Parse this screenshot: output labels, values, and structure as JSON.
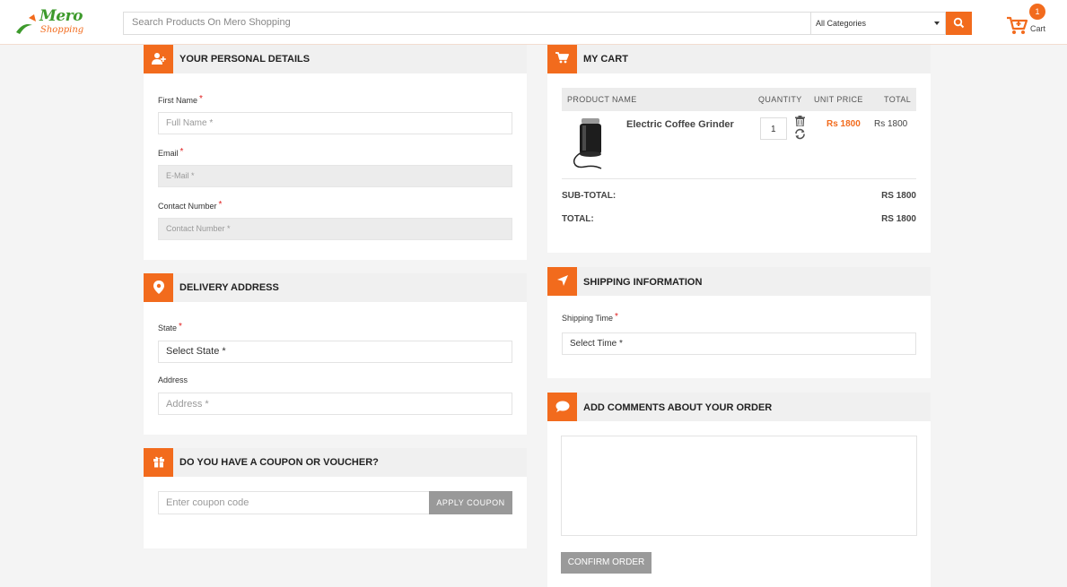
{
  "header": {
    "logo_line1": "Mero",
    "logo_line2": "Shopping",
    "search_placeholder": "Search Products On Mero Shopping",
    "category_selected": "All Categories",
    "cart_count": "1",
    "cart_label": "Cart"
  },
  "personal": {
    "title": "YOUR PERSONAL DETAILS",
    "first_name_label": "First Name",
    "first_name_placeholder": "Full Name *",
    "email_label": "Email",
    "email_placeholder": "E-Mail *",
    "contact_label": "Contact Number",
    "contact_placeholder": "Contact Number *",
    "required_mark": "*"
  },
  "delivery": {
    "title": "DELIVERY ADDRESS",
    "state_label": "State",
    "state_selected": "Select State *",
    "address_label": "Address",
    "address_placeholder": "Address *",
    "required_mark": "*"
  },
  "coupon": {
    "title": "DO YOU HAVE A COUPON OR VOUCHER?",
    "placeholder": "Enter coupon code",
    "button": "APPLY COUPON"
  },
  "cart": {
    "title": "MY CART",
    "columns": [
      "PRODUCT NAME",
      "QUANTITY",
      "UNIT PRICE",
      "TOTAL"
    ],
    "items": [
      {
        "name": "Electric Coffee Grinder",
        "quantity": "1",
        "unit_price": "Rs 1800",
        "total": "Rs 1800"
      }
    ],
    "subtotal_label": "SUB-TOTAL:",
    "subtotal_value": "RS 1800",
    "total_label": "TOTAL:",
    "total_value": "RS 1800"
  },
  "shipping": {
    "title": "SHIPPING INFORMATION",
    "time_label": "Shipping Time",
    "time_selected": "Select Time *",
    "required_mark": "*"
  },
  "comments": {
    "title": "ADD COMMENTS ABOUT YOUR ORDER",
    "confirm_button": "CONFIRM ORDER"
  },
  "colors": {
    "accent": "#f26b1d",
    "logo_green": "#3d9a2c",
    "required": "#e02020"
  }
}
